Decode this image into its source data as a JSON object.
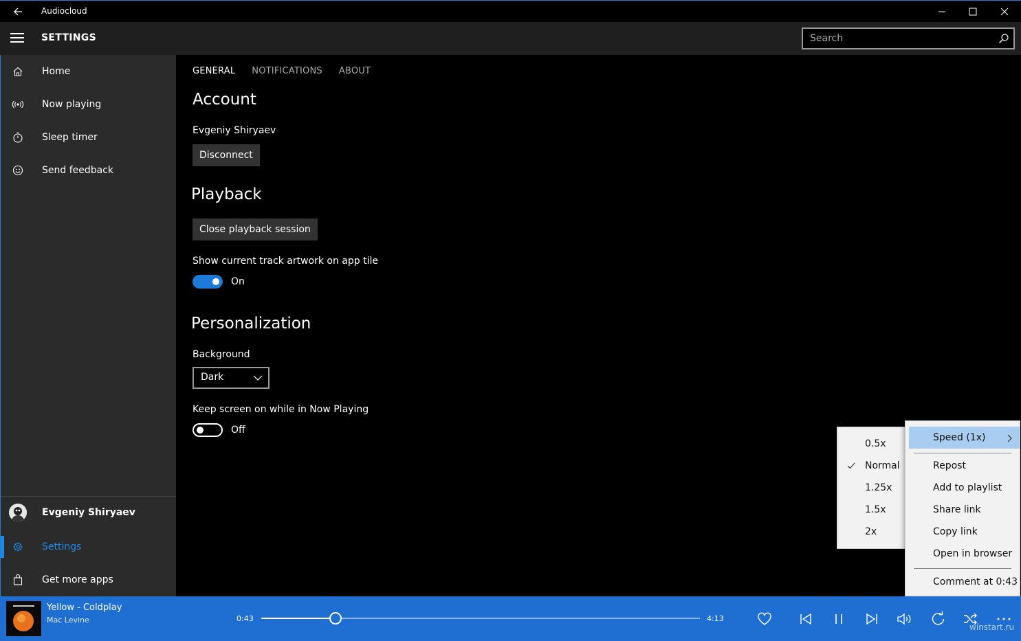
{
  "window": {
    "title": "Audiocloud"
  },
  "header": {
    "title": "SETTINGS",
    "search_placeholder": "Search"
  },
  "sidebar": {
    "items": [
      {
        "label": "Home",
        "icon": "home-icon"
      },
      {
        "label": "Now playing",
        "icon": "broadcast-icon"
      },
      {
        "label": "Sleep timer",
        "icon": "timer-icon"
      },
      {
        "label": "Send feedback",
        "icon": "smiley-icon"
      }
    ],
    "bottom": [
      {
        "label": "Evgeniy  Shiryaev",
        "icon": "avatar"
      },
      {
        "label": "Settings",
        "icon": "gear-icon",
        "active": true
      },
      {
        "label": "Get more apps",
        "icon": "store-bag-icon"
      }
    ]
  },
  "tabs": [
    "GENERAL",
    "NOTIFICATIONS",
    "ABOUT"
  ],
  "account": {
    "heading": "Account",
    "user": "Evgeniy  Shiryaev",
    "disconnect_label": "Disconnect"
  },
  "playback": {
    "heading": "Playback",
    "close_session_label": "Close playback session",
    "artwork_label": "Show current track artwork on app tile",
    "artwork_state": "On"
  },
  "personalization": {
    "heading": "Personalization",
    "background_label": "Background",
    "background_value": "Dark",
    "keep_screen_label": "Keep screen on while in Now Playing",
    "keep_screen_state": "Off"
  },
  "speed_menu": {
    "items": [
      "0.5x",
      "Normal",
      "1.25x",
      "1.5x",
      "2x"
    ],
    "checked": "Normal"
  },
  "more_menu": {
    "speed_label": "Speed (1x)",
    "items": [
      "Repost",
      "Add to playlist",
      "Share link",
      "Copy link",
      "Open in browser"
    ],
    "comment_label": "Comment at 0:43"
  },
  "player": {
    "track": "Yellow - Coldplay",
    "artist": "Mac Levine",
    "current_time": "0:43",
    "total_time": "4:13",
    "progress": 0.17
  },
  "watermark": "winstart.ru",
  "colors": {
    "accent": "#1e6fd1",
    "sidebar": "#2b2b2b",
    "header": "#1f1f1f",
    "menu": "#f2f2f2"
  }
}
